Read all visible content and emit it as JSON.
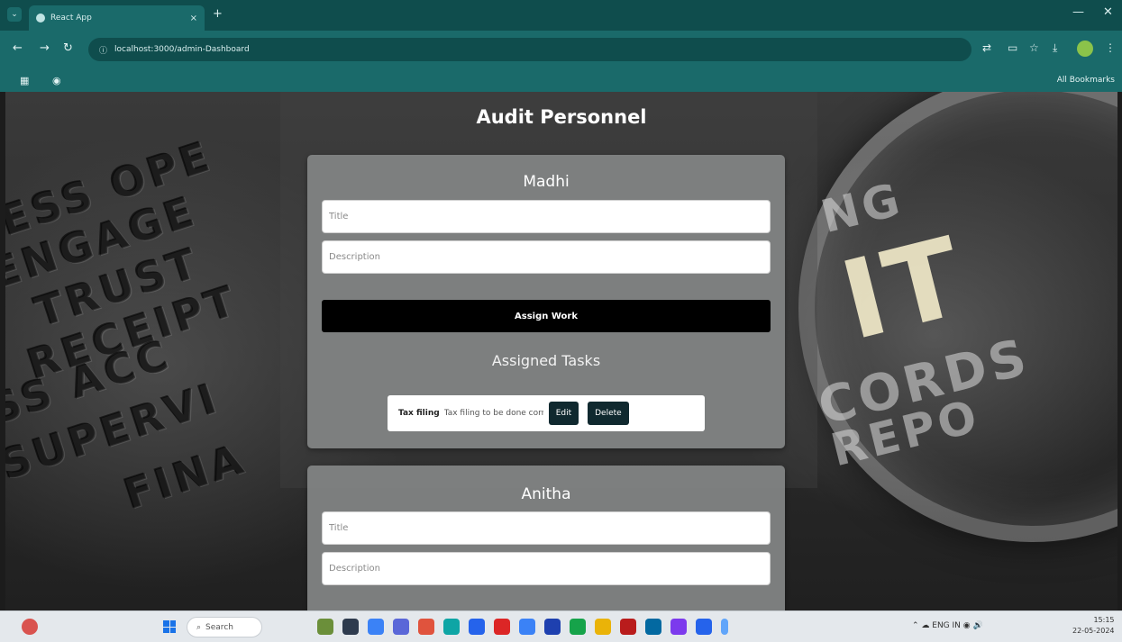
{
  "browser": {
    "tab_title": "React App",
    "tab_close": "×",
    "new_tab": "+",
    "address": "localhost:3000/admin-Dashboard",
    "bookmarks_all": "All Bookmarks",
    "window_min": "—",
    "window_close": "✕"
  },
  "page": {
    "title": "Audit Personnel",
    "background_words": [
      "ESS OPE",
      "ENGAGE",
      "TRUST",
      "RECEIPT",
      "SS ACC",
      "SUPERVI",
      "FINA"
    ],
    "lens_words": [
      "NG",
      "IT",
      "CORDS",
      "REPO"
    ]
  },
  "cards": [
    {
      "name": "Madhi",
      "title_placeholder": "Title",
      "description_placeholder": "Description",
      "assign_label": "Assign Work",
      "tasks_heading": "Assigned Tasks",
      "tasks": [
        {
          "title": "Tax filing",
          "description": "Tax filing to be done correctly",
          "edit_label": "Edit",
          "delete_label": "Delete"
        }
      ]
    },
    {
      "name": "Anitha",
      "title_placeholder": "Title",
      "description_placeholder": "Description"
    }
  ],
  "taskbar": {
    "search_placeholder": "Search",
    "tray_text": "ENG IN",
    "time": "15:15",
    "date": "22-05-2024"
  }
}
